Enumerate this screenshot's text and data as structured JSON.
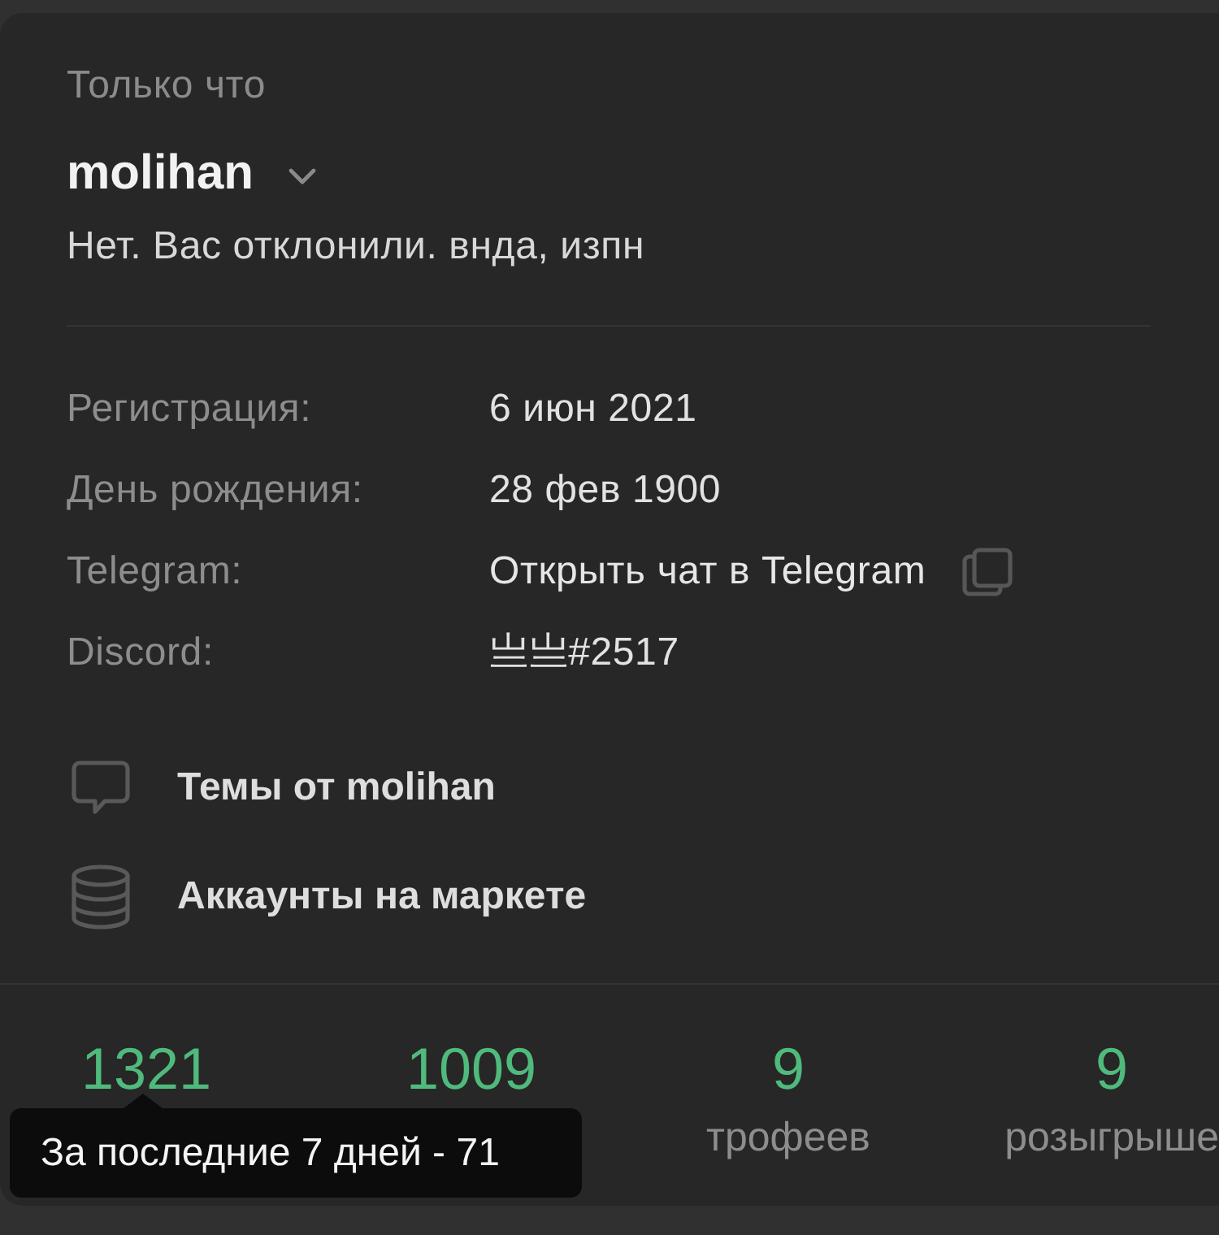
{
  "timestamp": "Только что",
  "user": {
    "name": "molihan",
    "status": "Нет. Вас отклонили. внда, изпн"
  },
  "details": [
    {
      "label": "Регистрация:",
      "value": "6 июн 2021",
      "kind": "text"
    },
    {
      "label": "День рождения:",
      "value": "28 фев 1900",
      "kind": "text"
    },
    {
      "label": "Telegram:",
      "value": "Открыть чат в Telegram",
      "kind": "link"
    },
    {
      "label": "Discord:",
      "value": "亗亗#2517",
      "kind": "text"
    }
  ],
  "links": [
    {
      "label": "Темы от molihan",
      "kind": "threads"
    },
    {
      "label": "Аккаунты на маркете",
      "kind": "market"
    }
  ],
  "stats": [
    {
      "value": "1321",
      "tooltip": "За последние 7 дней - 71"
    },
    {
      "value": "1009"
    },
    {
      "value": "9",
      "label": "трофеев"
    },
    {
      "value": "9",
      "label": "розыгрыше"
    }
  ]
}
